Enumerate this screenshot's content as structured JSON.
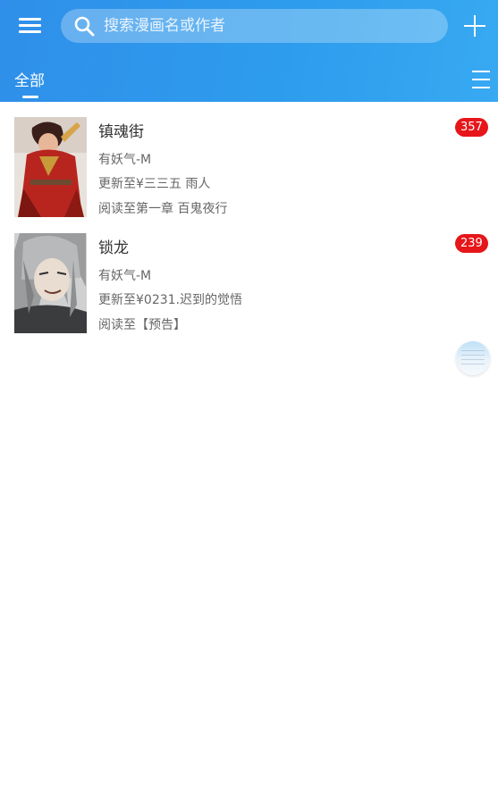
{
  "header": {
    "search_placeholder": "搜索漫画名或作者",
    "tab_all": "全部"
  },
  "icons": {
    "menu": "hamburger-icon",
    "search": "search-icon",
    "add": "plus-icon",
    "view": "list-icon",
    "float": "floating-menu-icon"
  },
  "colors": {
    "header": "#2e98ec",
    "badge": "#e6161a"
  },
  "comics": [
    {
      "title": "镇魂街",
      "author": "有妖气-M",
      "update": "更新至¥三三五 雨人",
      "progress": "阅读至第一章 百鬼夜行",
      "badge": "357"
    },
    {
      "title": "锁龙",
      "author": "有妖气-M",
      "update": "更新至¥0231.迟到的觉悟",
      "progress": "阅读至【预告】",
      "badge": "239"
    }
  ]
}
